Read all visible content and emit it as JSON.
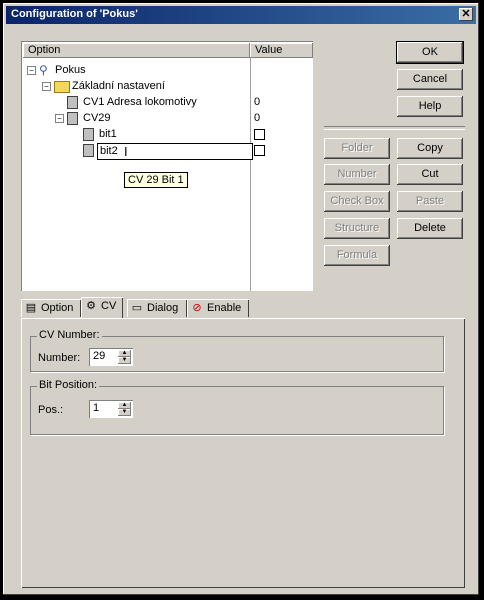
{
  "window": {
    "title": "Configuration of 'Pokus'",
    "close_icon": "close-icon"
  },
  "tree": {
    "headers": {
      "option": "Option",
      "value": "Value"
    },
    "nodes": [
      {
        "label": "Pokus",
        "icon": "device-icon",
        "value": ""
      },
      {
        "label": "Základní nastavení",
        "icon": "folder-icon",
        "value": ""
      },
      {
        "label": "CV1 Adresa lokomotivy",
        "icon": "cv-icon",
        "value": "0"
      },
      {
        "label": "CV29",
        "icon": "checkbox-cv-icon",
        "value": "0"
      },
      {
        "label": "bit1",
        "icon": "bit-icon",
        "value": "unchecked"
      },
      {
        "label": "bit2",
        "icon": "bit-icon",
        "value": "unchecked"
      }
    ],
    "tooltip": "CV 29 Bit 1"
  },
  "buttons": {
    "ok": "OK",
    "cancel": "Cancel",
    "help": "Help",
    "folder": "Folder",
    "number": "Number",
    "checkbox": "Check Box",
    "structure": "Structure",
    "formula": "Formula",
    "copy": "Copy",
    "cut": "Cut",
    "paste": "Paste",
    "delete": "Delete"
  },
  "tabs": [
    {
      "label": "Option",
      "icon": "option-icon",
      "active": false
    },
    {
      "label": "CV",
      "icon": "cv-tab-icon",
      "active": true
    },
    {
      "label": "Dialog",
      "icon": "dialog-icon",
      "active": false
    },
    {
      "label": "Enable",
      "icon": "enable-icon",
      "active": false
    }
  ],
  "cv_panel": {
    "cv_group": {
      "title": "CV Number:",
      "label": "Number:",
      "value": "29"
    },
    "bit_group": {
      "title": "Bit Position:",
      "label": "Pos.:",
      "value": "1"
    }
  }
}
